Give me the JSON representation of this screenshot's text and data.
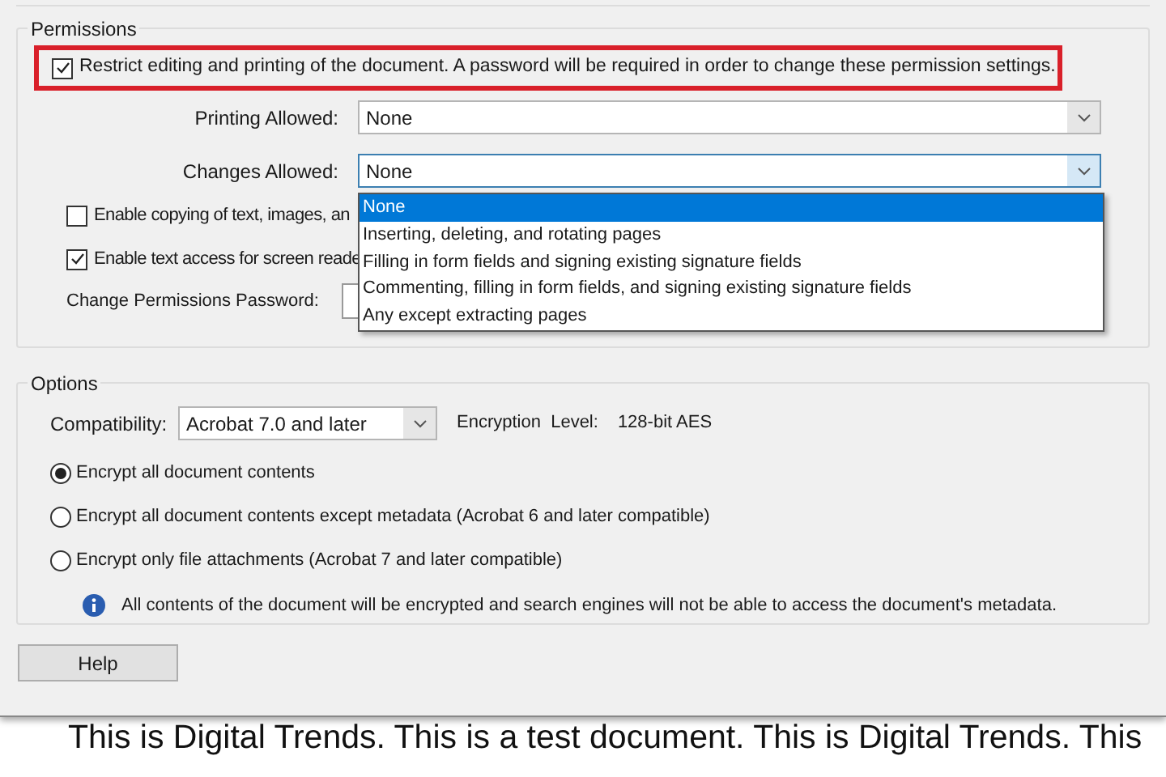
{
  "permissions": {
    "title": "Permissions",
    "restrict": {
      "label": "Restrict editing and printing of the document. A password will be required in order to change these permission settings.",
      "checked": true,
      "highlighted": true
    },
    "printing": {
      "label": "Printing Allowed:",
      "value": "None"
    },
    "changes": {
      "label": "Changes Allowed:",
      "value": "None",
      "expanded": true,
      "options": [
        {
          "label": "None",
          "selected": true
        },
        {
          "label": "Inserting, deleting, and rotating pages",
          "selected": false
        },
        {
          "label": "Filling in form fields and signing existing signature fields",
          "selected": false
        },
        {
          "label": "Commenting, filling in form fields, and signing existing signature fields",
          "selected": false
        },
        {
          "label": "Any except extracting pages",
          "selected": false
        }
      ]
    },
    "checkboxes": [
      {
        "label": "Enable copying of text, images, an",
        "checked": false
      },
      {
        "label": "Enable text access for screen reade",
        "checked": true
      }
    ],
    "password": {
      "label": "Change Permissions Password:"
    }
  },
  "options": {
    "title": "Options",
    "compatibility": {
      "label": "Compatibility:",
      "value": "Acrobat 7.0 and later"
    },
    "encryption": {
      "label": "Encryption  Level:",
      "value": "128-bit AES"
    },
    "radios": [
      {
        "label": "Encrypt all document contents",
        "selected": true
      },
      {
        "label": "Encrypt all document contents except metadata (Acrobat 6 and later compatible)",
        "selected": false
      },
      {
        "label": "Encrypt only file attachments (Acrobat 7 and later compatible)",
        "selected": false
      }
    ],
    "info": "All contents of the document will be encrypted and search engines will not be able to access the document's metadata."
  },
  "help_button": "Help",
  "document_lines": [
    "This is Digital Trends. This is a test document. This is Digital Trends. This"
  ]
}
